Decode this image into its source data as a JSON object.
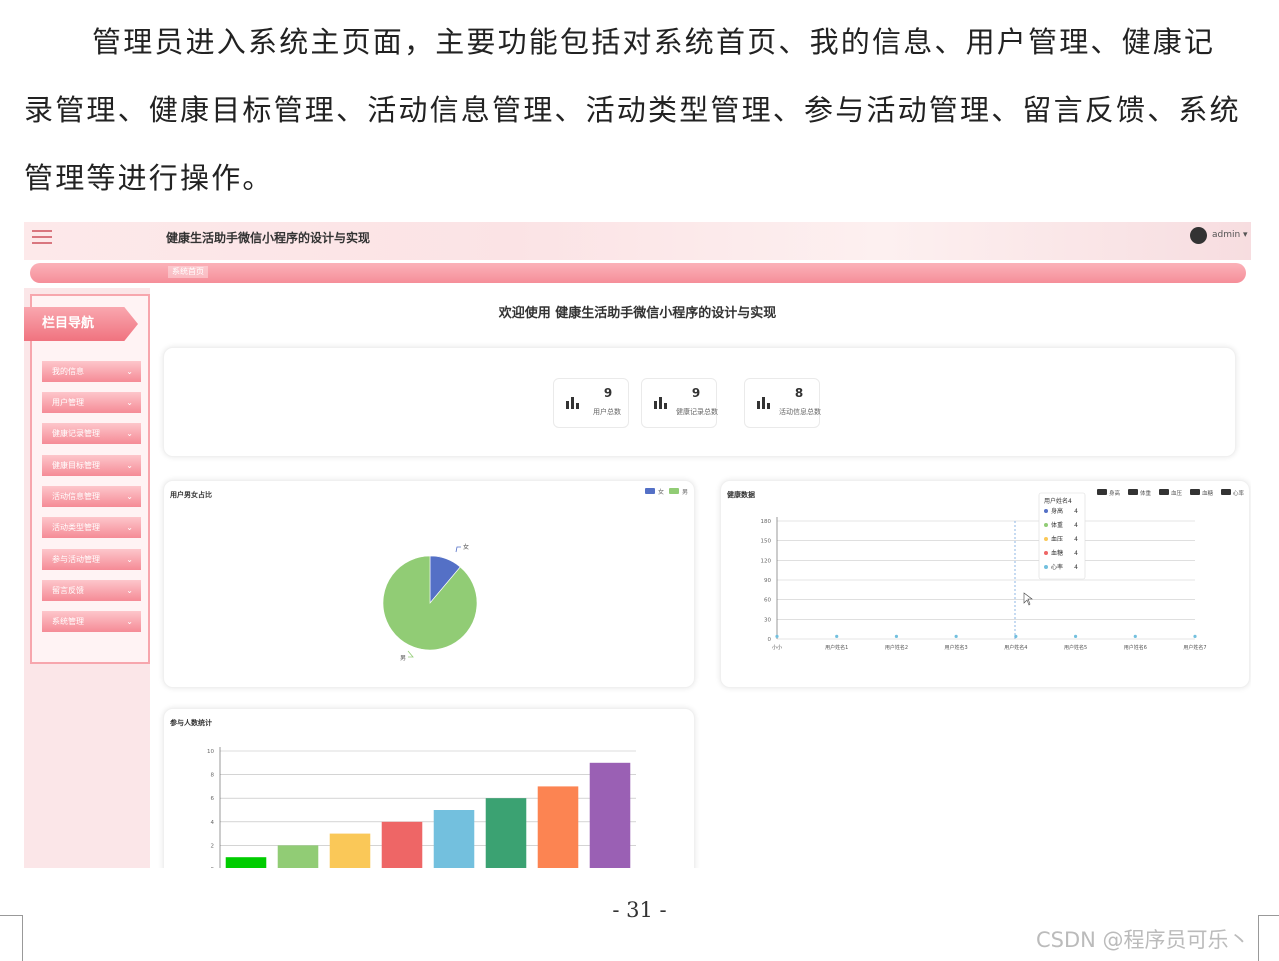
{
  "paragraph": "管理员进入系统主页面，主要功能包括对系统首页、我的信息、用户管理、健康记录管理、健康目标管理、活动信息管理、活动类型管理、参与活动管理、留言反馈、系统管理等进行操作。",
  "app": {
    "title": "健康生活助手微信小程序的设计与实现",
    "user": "admin ▾",
    "tab": "系统首页",
    "nav_title": "栏目导航",
    "nav_items": [
      "我的信息",
      "用户管理",
      "健康记录管理",
      "健康目标管理",
      "活动信息管理",
      "活动类型管理",
      "参与活动管理",
      "留言反馈",
      "系统管理"
    ],
    "welcome": "欢迎使用 健康生活助手微信小程序的设计与实现",
    "stats": [
      {
        "value": "9",
        "label": "用户总数"
      },
      {
        "value": "9",
        "label": "健康记录总数"
      },
      {
        "value": "8",
        "label": "活动信息总数"
      }
    ]
  },
  "colors": {
    "accent": "#f58e99",
    "pie_female": "#5470c6",
    "pie_male": "#91cc75"
  },
  "chart_data": [
    {
      "type": "pie",
      "title": "用户男女占比",
      "legend": [
        "女",
        "男"
      ],
      "labels": [
        "女",
        "男"
      ],
      "values": [
        1,
        8
      ]
    },
    {
      "type": "line",
      "title": "健康数据",
      "legend": [
        "身高",
        "体重",
        "血压",
        "血糖",
        "心率"
      ],
      "categories": [
        "小小",
        "用户姓名1",
        "用户姓名2",
        "用户姓名3",
        "用户姓名4",
        "用户姓名5",
        "用户姓名6",
        "用户姓名7"
      ],
      "yticks": [
        "180",
        "150",
        "120",
        "90",
        "60",
        "30",
        "0"
      ],
      "ylim": [
        0,
        180
      ],
      "tooltip": {
        "title": "用户姓名4",
        "rows": [
          {
            "name": "身高",
            "value": "4",
            "color": "#5470c6"
          },
          {
            "name": "体重",
            "value": "4",
            "color": "#91cc75"
          },
          {
            "name": "血压",
            "value": "4",
            "color": "#fac858"
          },
          {
            "name": "血糖",
            "value": "4",
            "color": "#ee6666"
          },
          {
            "name": "心率",
            "value": "4",
            "color": "#73c0de"
          }
        ]
      }
    },
    {
      "type": "bar",
      "title": "参与人数统计",
      "yticks": [
        "10",
        "8",
        "6",
        "4",
        "2",
        "0"
      ],
      "ylim": [
        0,
        10
      ],
      "values": [
        1,
        2,
        3,
        4,
        5,
        6,
        7,
        9
      ],
      "colors": [
        "#00cc00",
        "#91cc75",
        "#fac858",
        "#ee6666",
        "#73c0de",
        "#3ba272",
        "#fc8452",
        "#9a60b4"
      ]
    }
  ],
  "page_number": "- 31 -",
  "watermark": "CSDN @程序员可乐丶"
}
